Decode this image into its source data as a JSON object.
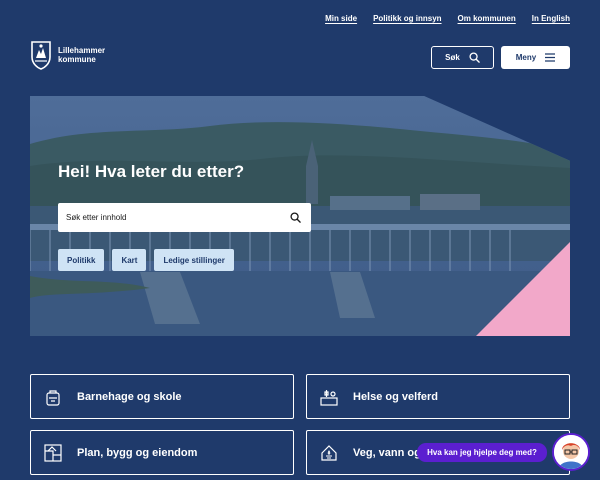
{
  "top_links": [
    "Min side",
    "Politikk og innsyn",
    "Om kommunen",
    "In English"
  ],
  "logo": {
    "line1": "Lillehammer",
    "line2": "kommune"
  },
  "header": {
    "search_label": "Søk",
    "menu_label": "Meny"
  },
  "hero": {
    "title": "Hei! Hva leter du etter?",
    "search_placeholder": "Søk etter innhold",
    "quick_links": [
      "Politikk",
      "Kart",
      "Ledige stillinger"
    ]
  },
  "categories": [
    {
      "label": "Barnehage og skole",
      "icon": "backpack-icon"
    },
    {
      "label": "Helse og velferd",
      "icon": "care-icon"
    },
    {
      "label": "Plan, bygg og eiendom",
      "icon": "building-plan-icon"
    },
    {
      "label": "Veg, vann og",
      "icon": "house-water-icon"
    }
  ],
  "chat": {
    "prompt": "Hva kan jeg hjelpe deg med?"
  },
  "colors": {
    "background": "#1f3a6b",
    "accent_pink": "#f2a8c9",
    "chip": "#cfe3f5",
    "chat": "#5b1fd0"
  }
}
